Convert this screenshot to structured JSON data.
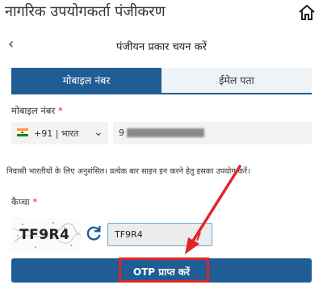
{
  "header": {
    "title": "नागरिक उपयोगकर्ता पंजीकरण",
    "home_icon": "home-icon"
  },
  "subheader": {
    "back_icon": "chevron-left-icon",
    "title": "पंजीयन प्रकार चयन करें"
  },
  "tabs": [
    {
      "label": "मोबाइल नंबर",
      "active": true
    },
    {
      "label": "ईमेल पता",
      "active": false
    }
  ],
  "mobile": {
    "label": "मोबाइल नंबर",
    "required_mark": "*",
    "country_code": "+91 | भारत",
    "phone_prefix": "9"
  },
  "note": "निवासी भारतीयों के लिए अनुशंसित। प्रत्येक बार साइन इन करने हेतु इसका उपयोग करें।",
  "captcha": {
    "label": "कैप्चा",
    "required_mark": "*",
    "image_text": "TF9R4",
    "input_value": "TF9R4",
    "refresh_icon": "refresh-icon"
  },
  "submit": {
    "label": "OTP प्राप्त करें"
  },
  "colors": {
    "primary": "#1f5d94",
    "highlight": "#e02626",
    "required": "#d22222"
  }
}
